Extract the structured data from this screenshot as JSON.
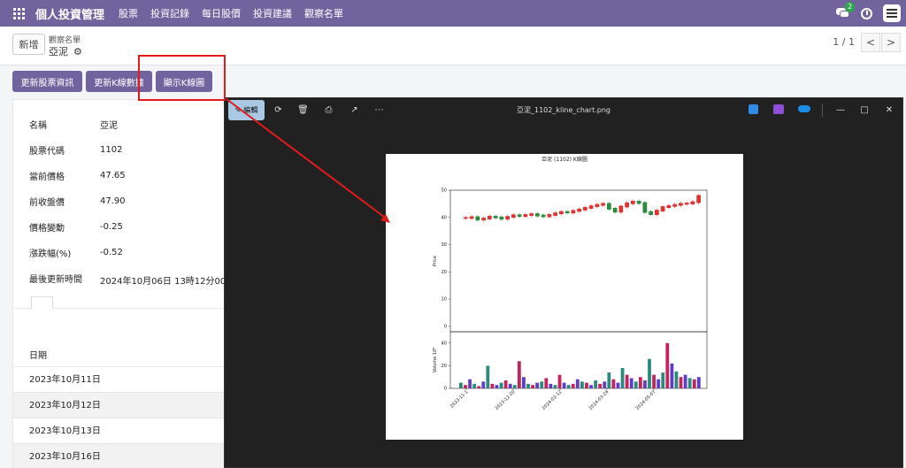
{
  "navbar": {
    "brand": "個人投資管理",
    "items": [
      "股票",
      "投資記錄",
      "每日股價",
      "投資建議",
      "觀察名單"
    ],
    "chat_badge": "2"
  },
  "control": {
    "new_label": "新增",
    "breadcrumb": "觀察名單",
    "record_title": "亞泥",
    "pager": "1 / 1",
    "prev": "<",
    "next": ">"
  },
  "actions": [
    "更新股票資訊",
    "更新K線數據",
    "顯示K線圖"
  ],
  "form": {
    "fields": [
      {
        "label": "名稱",
        "value": "亞泥"
      },
      {
        "label": "股票代碼",
        "value": "1102"
      },
      {
        "label": "當前價格",
        "value": "47.65"
      },
      {
        "label": "前收盤價",
        "value": "47.90"
      },
      {
        "label": "價格變動",
        "value": "-0.25"
      },
      {
        "label": "漲跌幅(%)",
        "value": "-0.52"
      },
      {
        "label": "最後更新時間",
        "value": "2024年10月06日 13時12分00秒"
      }
    ]
  },
  "table": {
    "header": "日期",
    "rows": [
      "2023年10月11日",
      "2023年10月12日",
      "2023年10月13日",
      "2023年10月16日"
    ]
  },
  "viewer": {
    "edit_label": "編輯",
    "title": "亞泥_1102_kline_chart.png",
    "minimize": "—",
    "maximize": "□",
    "close": "✕"
  },
  "chart_data": {
    "type": "line",
    "title": "亞泥 (1102) K線圖",
    "ylabel": "Price",
    "ylim": [
      -2,
      50
    ],
    "yticks": [
      0,
      10,
      20,
      30,
      40,
      50
    ],
    "price_series": [
      39.8,
      40.1,
      39.2,
      39.6,
      40.3,
      40.0,
      39.5,
      40.2,
      40.8,
      40.5,
      40.9,
      41.2,
      40.7,
      40.4,
      40.9,
      41.5,
      42.0,
      41.8,
      42.4,
      42.9,
      43.5,
      44.1,
      44.6,
      45.0,
      43.2,
      42.1,
      44.0,
      45.2,
      45.8,
      45.3,
      42.0,
      41.2,
      42.5,
      43.8,
      44.2,
      44.6,
      45.0,
      45.1,
      45.6,
      47.9
    ],
    "volume_label": "Volume 10⁶",
    "volume_ylim": [
      0,
      50
    ],
    "volume_yticks": [
      0,
      20,
      40
    ],
    "volume_series": [
      5,
      3,
      8,
      4,
      2,
      6,
      20,
      4,
      3,
      5,
      7,
      4,
      3,
      24,
      10,
      4,
      3,
      5,
      6,
      9,
      4,
      3,
      12,
      5,
      3,
      4,
      8,
      6,
      5,
      3,
      7,
      4,
      6,
      14,
      8,
      5,
      18,
      12,
      9,
      6,
      10,
      7,
      26,
      12,
      8,
      14,
      40,
      22,
      15,
      10,
      12,
      9,
      8,
      10
    ],
    "x_ticks": [
      "2023-11-1",
      "2023-12-20",
      "2024-02-12",
      "2024-03-24",
      "2024-05-07"
    ]
  }
}
